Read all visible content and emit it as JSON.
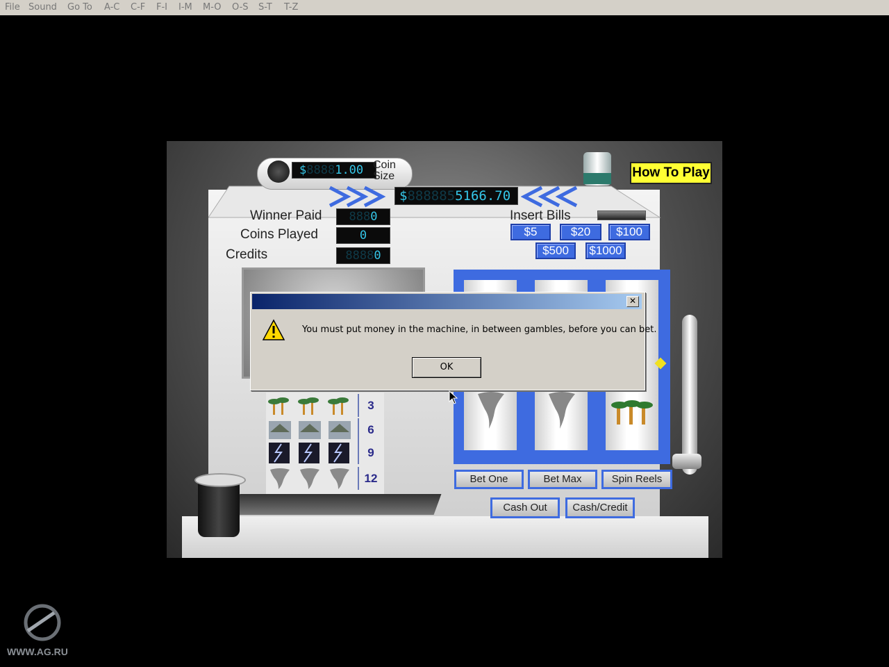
{
  "menu": {
    "items": [
      "File",
      "Sound",
      "Go To",
      "A-C",
      "C-F",
      "F-I",
      "I-M",
      "M-O",
      "O-S",
      "S-T",
      "T-Z"
    ]
  },
  "machine": {
    "coin_size_value": "1.00",
    "coin_size_ghost": "8888",
    "coin_size_currency": "$",
    "coin_size_label": "Coin\nSize",
    "balance_currency": "$",
    "balance_ghost": "888885",
    "balance_value": "5166.70",
    "how_to_play": "How To Play",
    "winner_paid_label": "Winner Paid",
    "winner_paid_value": "0",
    "winner_paid_ghost": "888",
    "coins_played_label": "Coins Played",
    "coins_played_value": "0",
    "credits_label": "Credits",
    "credits_value": "0",
    "credits_ghost": "8888",
    "insert_bills_label": "Insert Bills",
    "bills": [
      "$5",
      "$20",
      "$100",
      "$500",
      "$1000"
    ],
    "paytable": [
      {
        "symbol": "palm-trees",
        "payout": "3"
      },
      {
        "symbol": "rooftops",
        "payout": "6"
      },
      {
        "symbol": "lightning",
        "payout": "9"
      },
      {
        "symbol": "tornado",
        "payout": "12"
      }
    ],
    "reel_symbols": [
      "tornado",
      "tornado",
      "palm-trees"
    ],
    "buttons": {
      "bet_one": "Bet One",
      "bet_max": "Bet Max",
      "spin_reels": "Spin Reels",
      "cash_out": "Cash Out",
      "cash_credit": "Cash/Credit"
    }
  },
  "dialog": {
    "message": "You must put money in the machine, in between gambles, before you can bet.",
    "ok": "OK",
    "close": "✕"
  },
  "watermark": "WWW.AG.RU",
  "colors": {
    "accent_blue": "#3e6be0",
    "lcd_cyan": "#35c6e8",
    "how_to_play_yellow": "#ffff33",
    "dialog_title": "#0a246a"
  }
}
